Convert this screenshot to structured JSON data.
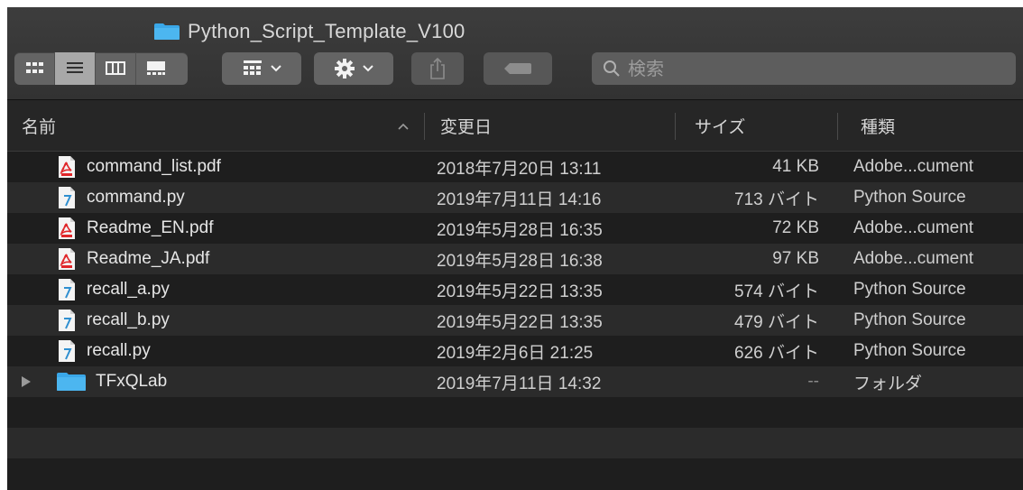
{
  "window": {
    "title": "Python_Script_Template_V100",
    "folder_color": "#3aa7e8"
  },
  "toolbar": {
    "view_modes": [
      "icon-view",
      "list-view",
      "column-view",
      "gallery-view"
    ],
    "active_view": "list-view",
    "search_placeholder": "検索"
  },
  "columns": {
    "name": "名前",
    "date": "変更日",
    "size": "サイズ",
    "kind": "種類"
  },
  "files": [
    {
      "name": "command_list.pdf",
      "date": "2018年7月20日 13:11",
      "size": "41 KB",
      "kind": "Adobe...cument",
      "icon": "pdf-icon"
    },
    {
      "name": "command.py",
      "date": "2019年7月11日 14:16",
      "size": "713 バイト",
      "kind": "Python Source",
      "icon": "python-file-icon"
    },
    {
      "name": "Readme_EN.pdf",
      "date": "2019年5月28日 16:35",
      "size": "72 KB",
      "kind": "Adobe...cument",
      "icon": "pdf-icon"
    },
    {
      "name": "Readme_JA.pdf",
      "date": "2019年5月28日 16:38",
      "size": "97 KB",
      "kind": "Adobe...cument",
      "icon": "pdf-icon"
    },
    {
      "name": "recall_a.py",
      "date": "2019年5月22日 13:35",
      "size": "574 バイト",
      "kind": "Python Source",
      "icon": "python-file-icon"
    },
    {
      "name": "recall_b.py",
      "date": "2019年5月22日 13:35",
      "size": "479 バイト",
      "kind": "Python Source",
      "icon": "python-file-icon"
    },
    {
      "name": "recall.py",
      "date": "2019年2月6日 21:25",
      "size": "626 バイト",
      "kind": "Python Source",
      "icon": "python-file-icon"
    },
    {
      "name": "TFxQLab",
      "date": "2019年7月11日 14:32",
      "size": "--",
      "kind": "フォルダ",
      "icon": "folder-icon"
    }
  ],
  "colors": {
    "background": "#1e1e1e",
    "row_alt": "#2b2b2b",
    "toolbar_button": "#646464",
    "pdf_red": "#e0262a",
    "folder_blue": "#3aa7e8"
  }
}
